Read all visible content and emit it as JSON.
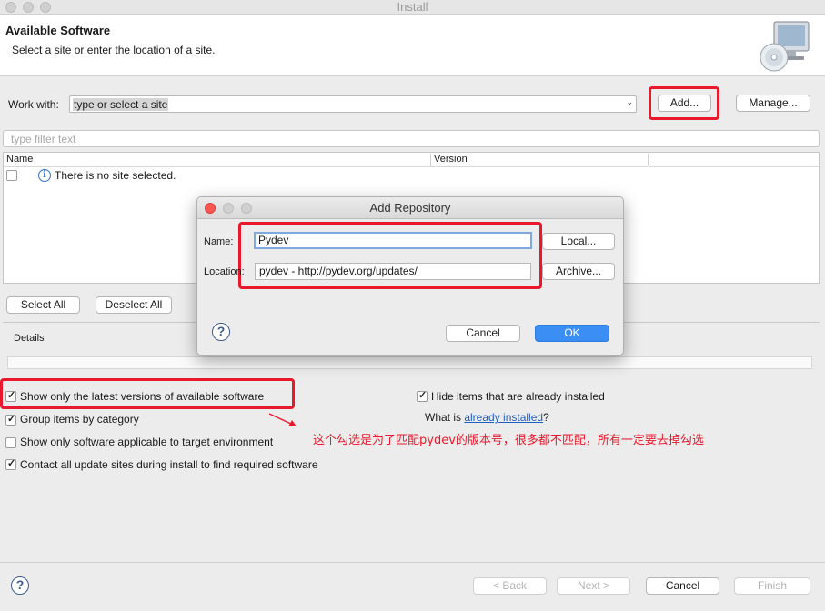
{
  "window": {
    "title": "Install"
  },
  "header": {
    "title": "Available Software",
    "subtitle": "Select a site or enter the location of a site."
  },
  "work_with": {
    "label": "Work with:",
    "value": "type or select a site",
    "add_button": "Add...",
    "manage_button": "Manage..."
  },
  "filter": {
    "placeholder": "type filter text"
  },
  "table": {
    "columns": [
      "Name",
      "Version"
    ],
    "rows": [
      {
        "name": "There is no site selected.",
        "checked": false
      }
    ]
  },
  "selection": {
    "select_all": "Select All",
    "deselect_all": "Deselect All"
  },
  "details": {
    "label": "Details"
  },
  "options": {
    "latest_versions": {
      "label": "Show only the latest versions of available software",
      "checked": true
    },
    "group_by_category": {
      "label": "Group items by category",
      "checked": true
    },
    "target_env": {
      "label": "Show only software applicable to target environment",
      "checked": false
    },
    "contact_sites": {
      "label": "Contact all update sites during install to find required software",
      "checked": true
    },
    "hide_installed": {
      "label": "Hide items that are already installed",
      "checked": true
    },
    "what_is_prefix": "What is ",
    "what_is_link": "already installed",
    "what_is_suffix": "?"
  },
  "annotation": {
    "text": "这个勾选是为了匹配pydev的版本号，很多都不匹配，所有一定要去掉勾选"
  },
  "footer": {
    "back": "< Back",
    "next": "Next >",
    "cancel": "Cancel",
    "finish": "Finish"
  },
  "dialog": {
    "title": "Add Repository",
    "name_label": "Name:",
    "name_value": "Pydev",
    "location_label": "Location:",
    "location_value": "pydev - http://pydev.org/updates/",
    "local_button": "Local...",
    "archive_button": "Archive...",
    "cancel_button": "Cancel",
    "ok_button": "OK"
  },
  "colors": {
    "highlight": "#e8192c",
    "ok_button": "#3b8ef4",
    "link": "#1f5fbf"
  },
  "icons": [
    "computer-cd-icon",
    "info-icon",
    "help-icon",
    "dropdown-arrow-icon",
    "annotation-arrow-icon"
  ]
}
